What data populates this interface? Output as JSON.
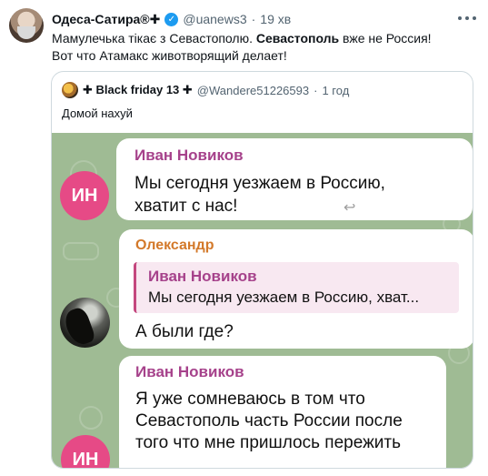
{
  "tweet": {
    "author_name": "Одеса-Сатира®✚",
    "handle": "@uanews3",
    "dot": "·",
    "time": "19 хв",
    "verified_glyph": "✓",
    "text_part1": "Мамулечька тікає з Севастополю. ",
    "text_bold": "Севастополь",
    "text_part2": " вже не Россия!",
    "text_line2": "Вот что Атамакс животворящий делает!",
    "more_icon": "more-horizontal-icon"
  },
  "quote": {
    "author_name": "✚ Black friday 13 ✚",
    "handle": "@Wandere51226593",
    "dot": "·",
    "time": "1 год",
    "text": "Домой нахуй",
    "screenshot": {
      "messages": [
        {
          "avatar_initials": "ИН",
          "sender": "Иван Новиков",
          "sender_color": "#a6428b",
          "line1": "Мы сегодня уезжаем в Россию,",
          "line2": "хватит с нас!"
        },
        {
          "sender": "Олександр",
          "sender_color": "#d3792a",
          "reply_sender": "Иван Новиков",
          "reply_text": "Мы сегодня уезжаем в Россию, хват...",
          "text": "А были где?"
        },
        {
          "avatar_initials": "ИН",
          "sender": "Иван Новиков",
          "sender_color": "#a6428b",
          "line1": "Я уже сомневаюсь в том что",
          "line2": "Севастополь часть России после",
          "line3": "того что мне пришлось пережить"
        }
      ],
      "background_color": "#9fbb94",
      "avatar_color": "#e64a86",
      "reply_bar_color": "#c4477e"
    }
  }
}
